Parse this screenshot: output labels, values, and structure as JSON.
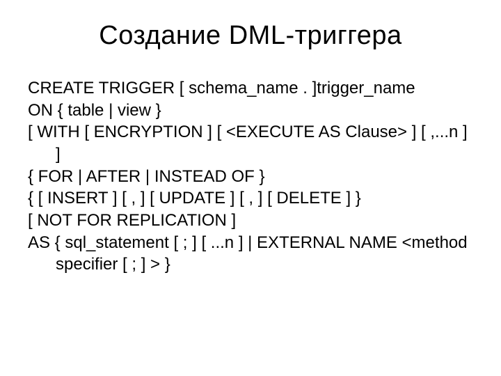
{
  "title": "Создание DML-триггера",
  "lines": [
    "CREATE TRIGGER [ schema_name . ]trigger_name",
    "ON { table | view }",
    "[ WITH [ ENCRYPTION ] [ <EXECUTE AS Clause> ] [ ,...n ] ]",
    "{ FOR | AFTER | INSTEAD OF }",
    "{ [ INSERT ] [ , ] [ UPDATE ] [ , ] [ DELETE ] }",
    "[ NOT FOR REPLICATION ]",
    "AS { sql_statement  [ ; ] [ ...n ] | EXTERNAL NAME <method specifier [ ; ] > }"
  ]
}
